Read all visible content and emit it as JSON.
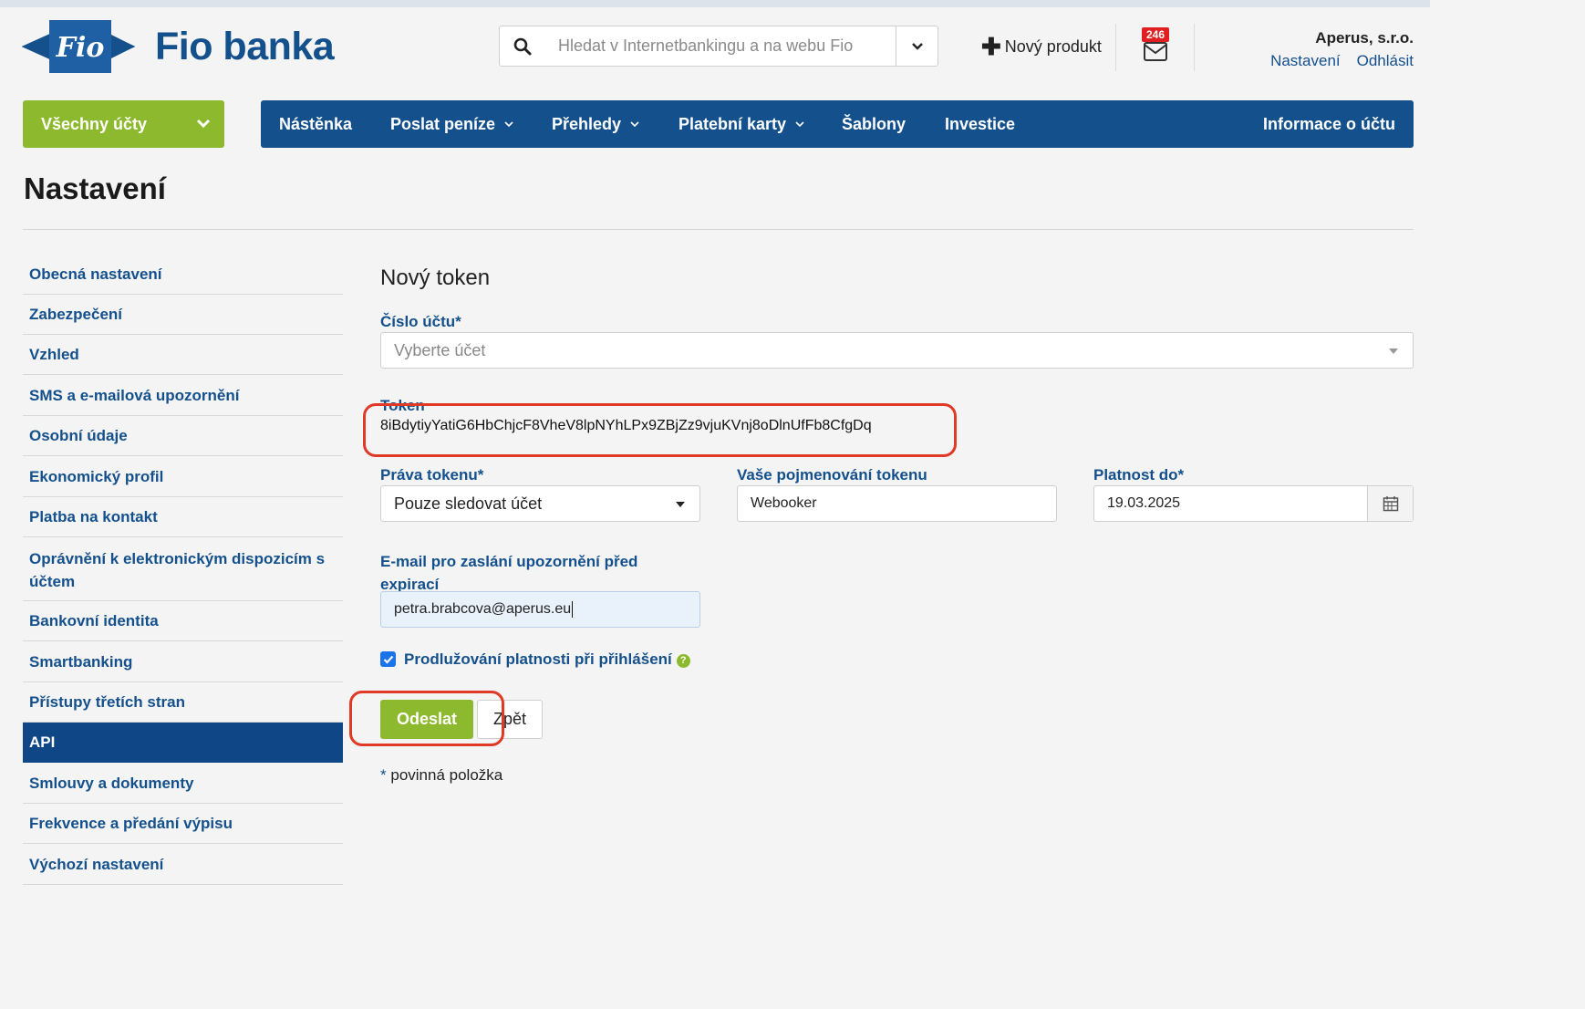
{
  "header": {
    "logo_text": "Fio banka",
    "logo_mark": "Fio",
    "search_placeholder": "Hledat v Internetbankingu a na webu Fio",
    "new_product": "Nový produkt",
    "mail_badge": "246",
    "company": "Aperus, s.r.o.",
    "settings_link": "Nastavení",
    "logout_link": "Odhlásit"
  },
  "nav": {
    "accounts": "Všechny účty",
    "items": [
      {
        "label": "Nástěnka",
        "dropdown": false
      },
      {
        "label": "Poslat peníze",
        "dropdown": true
      },
      {
        "label": "Přehledy",
        "dropdown": true
      },
      {
        "label": "Platební karty",
        "dropdown": true
      },
      {
        "label": "Šablony",
        "dropdown": false
      },
      {
        "label": "Investice",
        "dropdown": false
      }
    ],
    "right_item": "Informace o účtu"
  },
  "page_title": "Nastavení",
  "sidebar": {
    "items": [
      "Obecná nastavení",
      "Zabezpečení",
      "Vzhled",
      "SMS a e-mailová upozornění",
      "Osobní údaje",
      "Ekonomický profil",
      "Platba na kontakt",
      "Oprávnění k elektronickým dispozicím s účtem",
      "Bankovní identita",
      "Smartbanking",
      "Přístupy třetích stran",
      "API",
      "Smlouvy a dokumenty",
      "Frekvence a předání výpisu",
      "Výchozí nastavení"
    ],
    "active": "API"
  },
  "form": {
    "title": "Nový token",
    "account_label": "Číslo účtu*",
    "account_placeholder": "Vyberte účet",
    "token_label": "Token",
    "token_value": "8iBdytiyYatiG6HbChjcF8VheV8lpNYhLPx9ZBjZz9vjuKVnj8oDlnUfFb8CfgDq",
    "rights_label": "Práva tokenu*",
    "rights_value": "Pouze sledovat účet",
    "name_label": "Vaše pojmenování tokenu",
    "name_value": "Webooker",
    "validity_label": "Platnost do*",
    "validity_value": "19.03.2025",
    "email_label": "E-mail pro zaslání upozornění před expirací",
    "email_value": "petra.brabcova@aperus.eu",
    "extend_label": "Prodlužování platnosti při přihlášení",
    "extend_checked": true,
    "help_glyph": "?",
    "submit_label": "Odeslat",
    "back_label": "Zpět",
    "required_star": "*",
    "required_note": "povinná položka"
  },
  "colors": {
    "brand_blue": "#14508c",
    "active_blue": "#0f4685",
    "green": "#8db92e",
    "annotation_red": "#e03a26",
    "badge_red": "#e02020"
  }
}
